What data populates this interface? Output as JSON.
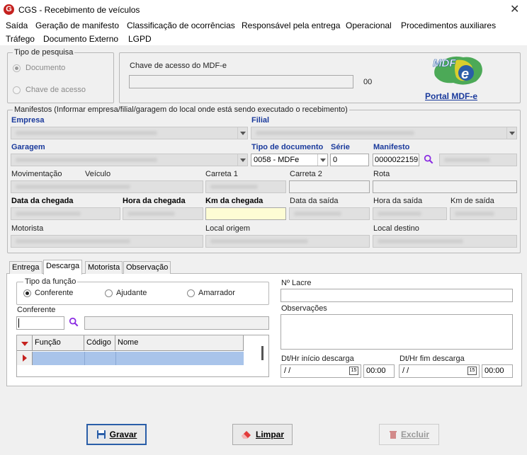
{
  "window": {
    "title": "CGS - Recebimento de veículos",
    "logo_letter": "G"
  },
  "menu": {
    "row1": [
      "Saída",
      "Geração de manifesto",
      "Classificação de ocorrências",
      "Responsável pela entrega",
      "Operacional",
      "Procedimentos auxiliares"
    ],
    "row2": [
      "Tráfego",
      "Documento Externo",
      "LGPD"
    ]
  },
  "tipo_pesquisa": {
    "legend": "Tipo de pesquisa",
    "opt_documento": "Documento",
    "opt_chave": "Chave de acesso"
  },
  "chave": {
    "label": "Chave de acesso do MDF-e",
    "value": "",
    "counter": "00"
  },
  "portal": {
    "link": "Portal MDF-e",
    "logo_text": "MDF"
  },
  "manifestos": {
    "legend": "Manifestos (Informar empresa/filial/garagem do local onde está sendo executado o recebimento)",
    "empresa": "Empresa",
    "filial": "Filial",
    "garagem": "Garagem",
    "tipo_doc": "Tipo de documento",
    "serie": "Série",
    "manifesto": "Manifesto",
    "tipo_doc_value": "0058 - MDFe",
    "serie_value": "0",
    "manifesto_value": "0000022159",
    "movimentacao": "Movimentação",
    "veiculo": "Veículo",
    "carreta1": "Carreta 1",
    "carreta2": "Carreta 2",
    "rota": "Rota",
    "data_chegada": "Data da chegada",
    "hora_chegada": "Hora da chegada",
    "km_chegada": "Km da chegada",
    "data_saida": "Data da saída",
    "hora_saida": "Hora da saída",
    "km_saida": "Km de saída",
    "motorista": "Motorista",
    "local_origem": "Local origem",
    "local_destino": "Local destino"
  },
  "tabs": [
    "Entrega",
    "Descarga",
    "Motorista",
    "Observação"
  ],
  "descarga": {
    "tipo_funcao": "Tipo da função",
    "opt_conferente": "Conferente",
    "opt_ajudante": "Ajudante",
    "opt_amarrador": "Amarrador",
    "conferente_label": "Conferente",
    "grid_cols": [
      "Função",
      "Código",
      "Nome"
    ],
    "lacre": "Nº Lacre",
    "observacoes": "Observações",
    "dt_inicio": "Dt/Hr início descarga",
    "dt_fim": "Dt/Hr fim descarga",
    "date_placeholder": " /  /",
    "time_value": "00:00",
    "cal_day": "15"
  },
  "buttons": {
    "gravar": "Gravar",
    "limpar": "Limpar",
    "excluir": "Excluir"
  },
  "colors": {
    "accent": "#1a3a9c",
    "selected_row": "#a9c4ea",
    "highlight_field": "#fdfcd4",
    "logo_red": "#c5221f"
  }
}
